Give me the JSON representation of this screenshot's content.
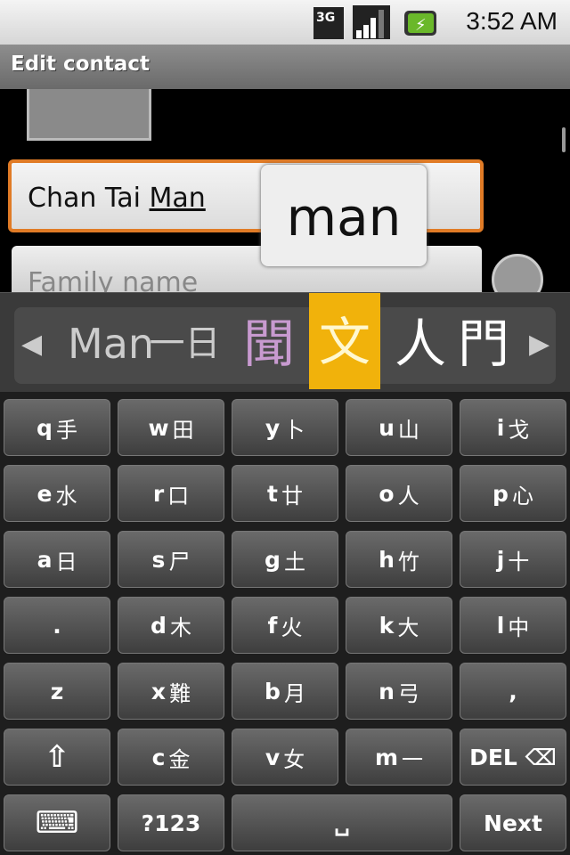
{
  "status": {
    "time": "3:52 AM",
    "network": "3G",
    "icons": [
      "3g-data-icon",
      "signal-icon",
      "battery-charging-icon"
    ]
  },
  "title": "Edit contact",
  "name_field": {
    "prefix": "Chan Tai ",
    "composing": "Man"
  },
  "composing_popup": "man",
  "family_field": {
    "placeholder": "Family name"
  },
  "candidates": {
    "items": [
      "Man",
      "一日弓",
      "聞",
      "文",
      "人",
      "門"
    ],
    "selected_index": 3,
    "colors": {
      "selected": "#f1b20b",
      "highlight": "#c89ad0"
    }
  },
  "keyboard": {
    "rows": [
      [
        {
          "k": "q",
          "h": "手"
        },
        {
          "k": "w",
          "h": "田"
        },
        {
          "k": "y",
          "h": "卜"
        },
        {
          "k": "u",
          "h": "山"
        },
        {
          "k": "i",
          "h": "戈"
        }
      ],
      [
        {
          "k": "e",
          "h": "水"
        },
        {
          "k": "r",
          "h": "口"
        },
        {
          "k": "t",
          "h": "廿"
        },
        {
          "k": "o",
          "h": "人"
        },
        {
          "k": "p",
          "h": "心"
        }
      ],
      [
        {
          "k": "a",
          "h": "日"
        },
        {
          "k": "s",
          "h": "尸"
        },
        {
          "k": "g",
          "h": "土"
        },
        {
          "k": "h",
          "h": "竹"
        },
        {
          "k": "j",
          "h": "十"
        }
      ],
      [
        {
          "k": ".",
          "h": ""
        },
        {
          "k": "d",
          "h": "木"
        },
        {
          "k": "f",
          "h": "火"
        },
        {
          "k": "k",
          "h": "大"
        },
        {
          "k": "l",
          "h": "中"
        }
      ],
      [
        {
          "k": "z",
          "h": ""
        },
        {
          "k": "x",
          "h": "難"
        },
        {
          "k": "b",
          "h": "月"
        },
        {
          "k": "n",
          "h": "弓"
        },
        {
          "k": ",",
          "h": ""
        }
      ],
      [
        {
          "k": "⇧",
          "h": ""
        },
        {
          "k": "c",
          "h": "金"
        },
        {
          "k": "v",
          "h": "女"
        },
        {
          "k": "m",
          "h": "一"
        },
        {
          "k": "DEL ⌫",
          "h": ""
        }
      ]
    ],
    "bottom": {
      "symbols": "?123",
      "next": "Next",
      "space": "␣"
    }
  }
}
